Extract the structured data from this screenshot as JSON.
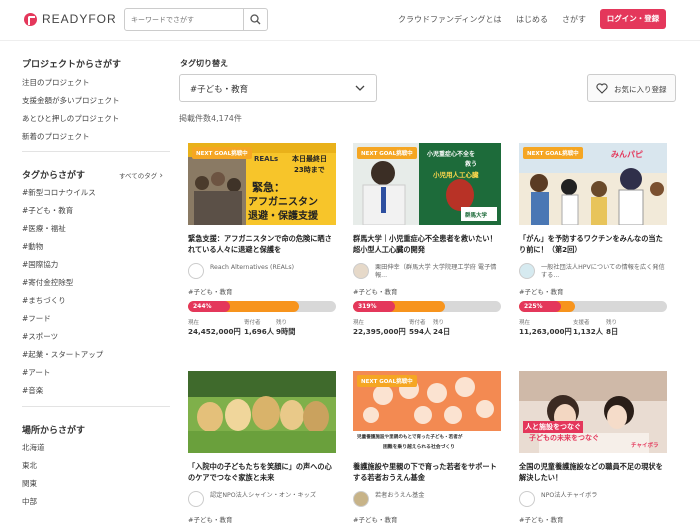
{
  "header": {
    "logo_text": "READYFOR",
    "search_placeholder": "キーワードでさがす",
    "nav": [
      "クラウドファンディングとは",
      "はじめる",
      "さがす"
    ],
    "login_label": "ログイン・登録",
    "brand_color": "#e4375b"
  },
  "sidebar": {
    "projects_heading": "プロジェクトからさがす",
    "project_links": [
      "注目のプロジェクト",
      "支援金額が多いプロジェクト",
      "あとひと押しのプロジェクト",
      "新着のプロジェクト"
    ],
    "tags_heading": "タグからさがす",
    "all_tags_label": "すべてのタグ",
    "tags": [
      "#新型コロナウイルス",
      "#子ども・教育",
      "#医療・福祉",
      "#動物",
      "#国際協力",
      "#寄付金控除型",
      "#まちづくり",
      "#フード",
      "#スポーツ",
      "#起業・スタートアップ",
      "#アート",
      "#音楽"
    ],
    "places_heading": "場所からさがす",
    "places": [
      "北海道",
      "東北",
      "関東",
      "中部"
    ]
  },
  "main": {
    "tag_switch_label": "タグ切り替え",
    "selected_tag": "#子ども・教育",
    "favorite_label": "お気に入り登録",
    "count_text": "掲載件数4,174件",
    "stat_labels": {
      "current": "現在",
      "supporters": "寄付者",
      "supporters_alt": "支援者",
      "remaining": "残り"
    }
  },
  "cards": [
    {
      "badge": "NEXT GOAL挑戦中",
      "thumb_lines": [
        "本日最終日",
        "23時まで",
        "緊急：",
        "アフガニスタン",
        "退避・保護支援"
      ],
      "thumb_logo": "REALs",
      "title": "緊急支援：アフガニスタンで命の危険に晒されている人々に退避と保護を",
      "owner": "Reach Alternatives (REALs)",
      "tag": "#子ども・教育",
      "percent_label": "244%",
      "progress": 0.75,
      "amount": "24,452,000円",
      "supporters": "1,696人",
      "remaining": "9時間",
      "supporter_label": "寄付者"
    },
    {
      "badge": "NEXT GOAL挑戦中",
      "thumb_lines": [
        "小児重症心不全を",
        "救う",
        "小児用人工心臓"
      ],
      "thumb_logo": "群馬大学",
      "title": "群馬大学｜小児重症心不全患者を救いたい！超小型人工心臓の開発",
      "owner": "栗田伸幸（群馬大学 大学院理工学府 電子情報...",
      "tag": "#子ども・教育",
      "percent_label": "319%",
      "progress": 0.62,
      "amount": "22,395,000円",
      "supporters": "594人",
      "remaining": "24日",
      "supporter_label": "寄付者"
    },
    {
      "badge": "NEXT GOAL挑戦中",
      "thumb_lines": [
        "みんパピ"
      ],
      "thumb_logo": "",
      "title": "「がん」を予防するワクチンをみんなの当たり前に！（第2回）",
      "owner": "一般社団法人HPVについての情報を広く発信する...",
      "tag": "#子ども・教育",
      "percent_label": "225%",
      "progress": 0.38,
      "amount": "11,263,000円",
      "supporters": "1,132人",
      "remaining": "8日",
      "supporter_label": "支援者"
    },
    {
      "badge": "",
      "thumb_lines": [],
      "thumb_logo": "",
      "title": "「入院中の子どもたちを笑顔に」の声への心のケアでつなぐ家族と未来",
      "owner": "認定NPO法人シャイン・オン・キッズ",
      "tag": "#子ども・教育"
    },
    {
      "badge": "NEXT GOAL挑戦中",
      "thumb_lines": [
        "児童養護施設や里親のもとで育った子ども・若者が",
        "困難を乗り越えられる社会づくり"
      ],
      "thumb_logo": "",
      "title": "養護施設や里親の下で育った若者をサポートする若者おうえん基金",
      "owner": "若者おうえん基金",
      "tag": "#子ども・教育"
    },
    {
      "badge": "",
      "thumb_lines": [
        "人と施設をつなぐ",
        "子どもの未来をつなぐ"
      ],
      "thumb_logo": "チャイボラ",
      "title": "全国の児童養護施設などの職員不足の現状を解決したい！",
      "owner": "NPO法人チャイボラ",
      "tag": "#子ども・教育"
    }
  ]
}
